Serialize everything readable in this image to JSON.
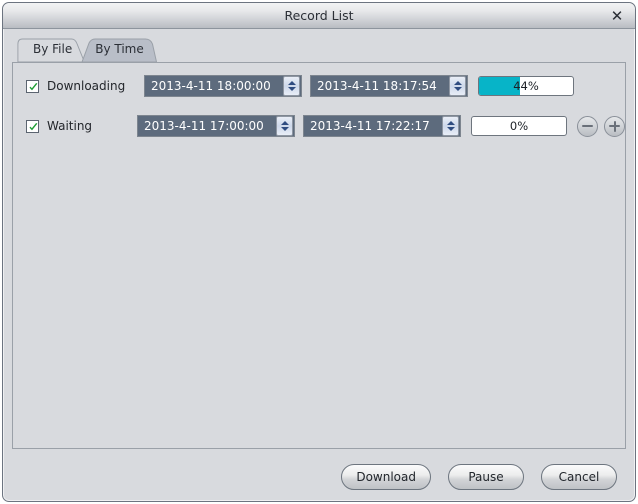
{
  "window": {
    "title": "Record List",
    "close_icon": "close-icon",
    "close_glyph": "✕"
  },
  "tabs": [
    {
      "label": "By File",
      "active": true
    },
    {
      "label": "By Time",
      "active": false
    }
  ],
  "rows": [
    {
      "checked": true,
      "status_label": "Downloading",
      "start_time": "2013-4-11 18:00:00",
      "end_time": "2013-4-11 18:17:54",
      "progress_text": "44%",
      "progress_value": 44,
      "progress_color": "#07b4c8",
      "has_stepper": false
    },
    {
      "checked": true,
      "status_label": "Waiting",
      "start_time": "2013-4-11 17:00:00",
      "end_time": "2013-4-11 17:22:17",
      "progress_text": "0%",
      "progress_value": 0,
      "progress_color": "#07b4c8",
      "has_stepper": true,
      "minus_label": "minus-icon",
      "plus_label": "plus-icon"
    }
  ],
  "footer": {
    "download_label": "Download",
    "pause_label": "Pause",
    "cancel_label": "Cancel"
  },
  "colors": {
    "window_bg": "#d8dade",
    "field_bg": "#5d6b7d",
    "accent": "#07b4c8",
    "check_green": "#1d9e34"
  }
}
